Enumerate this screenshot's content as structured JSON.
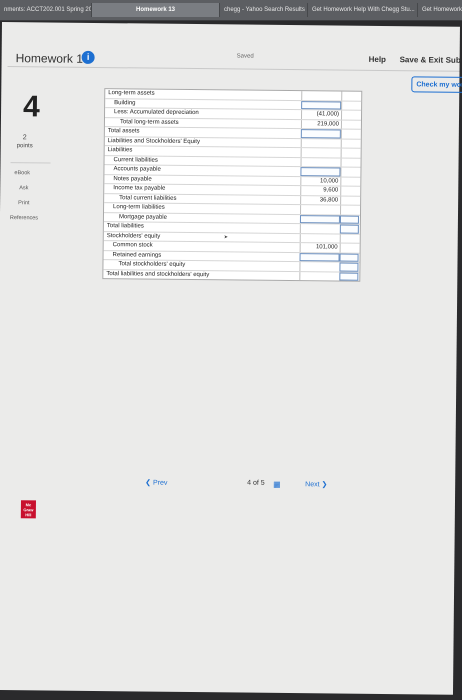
{
  "browser": {
    "tabs": [
      {
        "label": "nments: ACCT202.001 Spring 2020"
      },
      {
        "label": "Homework 13"
      },
      {
        "label": "chegg - Yahoo Search Results"
      },
      {
        "label": "Get Homework Help With Chegg Stu..."
      },
      {
        "label": "Get Homework Help"
      }
    ]
  },
  "header": {
    "title": "Homework 13",
    "info_icon": "i",
    "saved": "Saved",
    "help": "Help",
    "save_exit": "Save & Exit",
    "submit": "Sub",
    "check_work": "Check my work"
  },
  "question": {
    "number": "4",
    "points_value": "2",
    "points_label": "points"
  },
  "sidebar": {
    "links": [
      {
        "label": "eBook"
      },
      {
        "label": "Ask"
      },
      {
        "label": "Print"
      },
      {
        "label": "References"
      }
    ]
  },
  "table": {
    "rows": [
      {
        "label": "Long-term assets",
        "value": ""
      },
      {
        "label": "Building",
        "value": ""
      },
      {
        "label": "Less: Accumulated depreciation",
        "value": "(41,000)"
      },
      {
        "label": "Total long-term assets",
        "value": "219,000"
      },
      {
        "label": "Total assets",
        "value": ""
      },
      {
        "label": "Liabilities and Stockholders' Equity",
        "value": ""
      },
      {
        "label": "Liabilities",
        "value": ""
      },
      {
        "label": "Current liabilities",
        "value": ""
      },
      {
        "label": "Accounts payable",
        "value": ""
      },
      {
        "label": "Notes payable",
        "value": "10,000"
      },
      {
        "label": "Income tax payable",
        "value": "9,600"
      },
      {
        "label": "Total current liabilities",
        "value": "36,800"
      },
      {
        "label": "Long-term liabilities",
        "value": ""
      },
      {
        "label": "Mortgage payable",
        "value": ""
      },
      {
        "label": "Total liabilities",
        "value": ""
      },
      {
        "label": "Stockholders' equity",
        "value": ""
      },
      {
        "label": "Common stock",
        "value": "101,000"
      },
      {
        "label": "Retained earnings",
        "value": ""
      },
      {
        "label": "Total stockholders' equity",
        "value": ""
      },
      {
        "label": "Total liabilities and stockholders' equity",
        "value": ""
      }
    ]
  },
  "pager": {
    "prev": "Prev",
    "position": "4 of 5",
    "next": "Next"
  },
  "logo": {
    "text": "Mc Graw Hill"
  }
}
